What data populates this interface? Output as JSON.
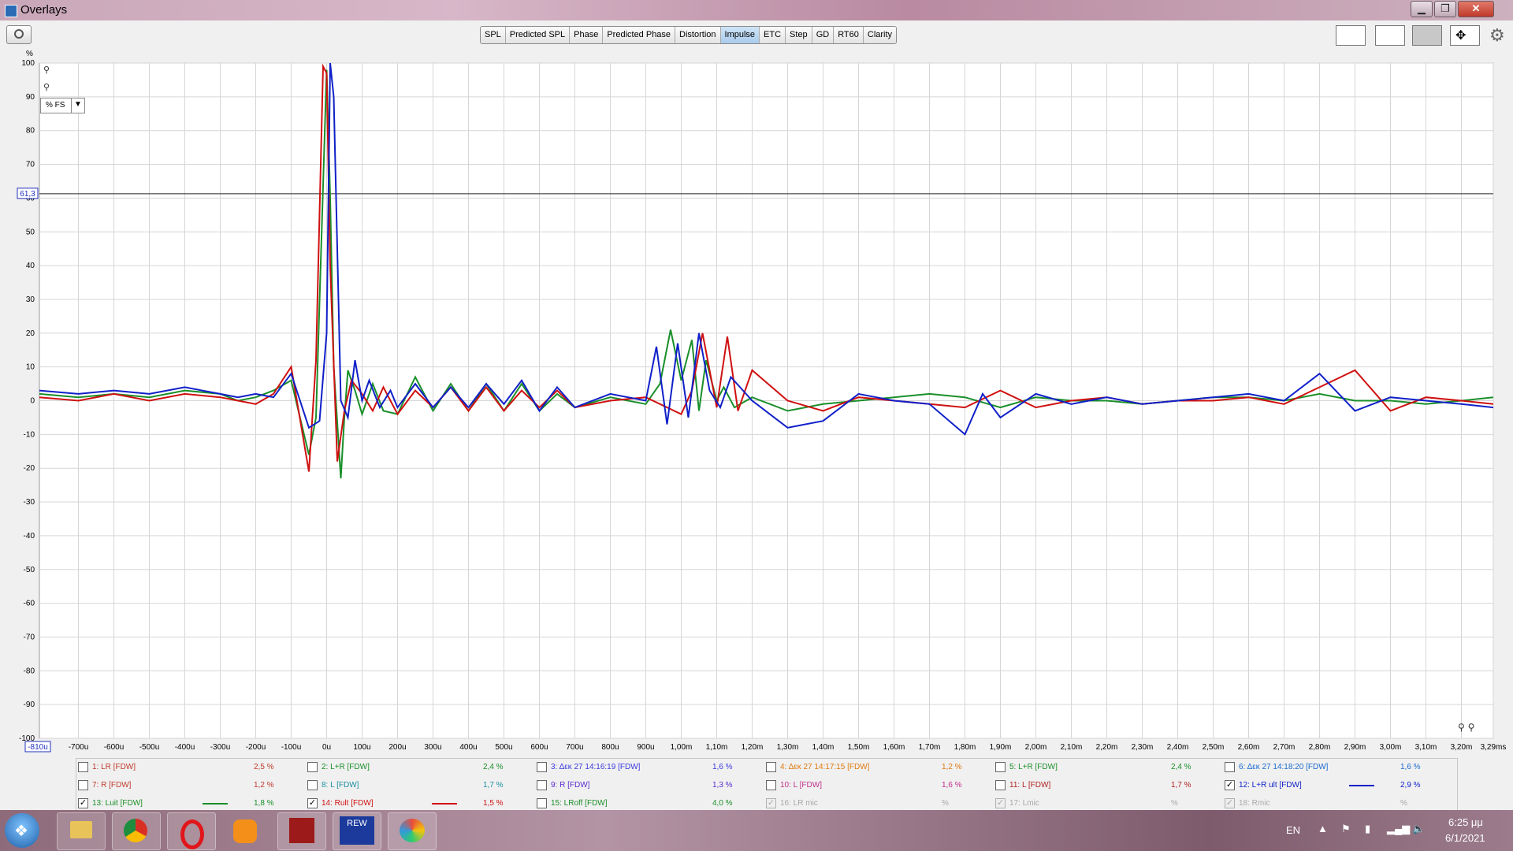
{
  "window": {
    "title": "Overlays",
    "minimize": "▁",
    "maximize": "❐",
    "close": "✕"
  },
  "tabs": [
    "SPL",
    "Predicted SPL",
    "Phase",
    "Predicted Phase",
    "Distortion",
    "Impulse",
    "ETC",
    "Step",
    "GD",
    "RT60",
    "Clarity"
  ],
  "active_tab": "Impulse",
  "y_unit_label": "%",
  "unit_select": "% FS",
  "cursor_value": "61,3",
  "x_cursor_value": "-810u",
  "chart_data": {
    "type": "line",
    "title": "",
    "xlabel": "",
    "ylabel": "%",
    "xlim": [
      -0.00081,
      0.00329
    ],
    "ylim": [
      -100,
      100
    ],
    "grid": true,
    "y_ticks": [
      "100",
      "90",
      "80",
      "70",
      "60",
      "50",
      "40",
      "30",
      "20",
      "10",
      "0",
      "-10",
      "-20",
      "-30",
      "-40",
      "-50",
      "-60",
      "-70",
      "-80",
      "-90",
      "-100"
    ],
    "x_ticks": [
      "-700u",
      "-600u",
      "-500u",
      "-400u",
      "-300u",
      "-200u",
      "-100u",
      "0u",
      "100u",
      "200u",
      "300u",
      "400u",
      "500u",
      "600u",
      "700u",
      "800u",
      "900u",
      "1,00m",
      "1,10m",
      "1,20m",
      "1,30m",
      "1,40m",
      "1,50m",
      "1,60m",
      "1,70m",
      "1,80m",
      "1,90m",
      "2,00m",
      "2,10m",
      "2,20m",
      "2,30m",
      "2,40m",
      "2,50m",
      "2,60m",
      "2,70m",
      "2,80m",
      "2,90m",
      "3,00m",
      "3,10m",
      "3,20m",
      "3,29ms"
    ],
    "cursor_y": 61.3,
    "series": [
      {
        "name": "13: Luit [FDW]",
        "color": "#1a8f2a",
        "x": [
          -0.00081,
          -0.0007,
          -0.0006,
          -0.0005,
          -0.0004,
          -0.0003,
          -0.00025,
          -0.0002,
          -0.00015,
          -0.0001,
          -5e-05,
          -3e-05,
          0,
          1e-05,
          2e-05,
          4e-05,
          5e-05,
          6e-05,
          8e-05,
          0.0001,
          0.00013,
          0.00016,
          0.0002,
          0.00025,
          0.0003,
          0.00035,
          0.0004,
          0.00045,
          0.0005,
          0.00055,
          0.0006,
          0.00065,
          0.0007,
          0.0008,
          0.0009,
          0.00094,
          0.00097,
          0.001,
          0.00103,
          0.00105,
          0.00107,
          0.0011,
          0.00112,
          0.00115,
          0.0012,
          0.0013,
          0.0014,
          0.0015,
          0.0016,
          0.0017,
          0.0018,
          0.0019,
          0.002,
          0.0021,
          0.0022,
          0.0023,
          0.0024,
          0.0025,
          0.0026,
          0.0027,
          0.0028,
          0.0029,
          0.003,
          0.0031,
          0.0032,
          0.00329
        ],
        "y": [
          2,
          1,
          2,
          1,
          3,
          2,
          0,
          1,
          3,
          6,
          -16,
          -5,
          98,
          60,
          10,
          -23,
          -5,
          9,
          3,
          -4,
          5,
          -3,
          -4,
          7,
          -3,
          5,
          -3,
          5,
          -3,
          5,
          -3,
          2,
          -2,
          1,
          -1,
          5,
          21,
          6,
          18,
          -3,
          12,
          0,
          4,
          -2,
          1,
          -3,
          -1,
          0,
          1,
          2,
          1,
          -2,
          1,
          0,
          0,
          -1,
          0,
          1,
          1,
          0,
          2,
          0,
          0,
          -1,
          0,
          1
        ]
      },
      {
        "name": "14: Rult [FDW]",
        "color": "#d01010",
        "x": [
          -0.00081,
          -0.0007,
          -0.0006,
          -0.0005,
          -0.0004,
          -0.0003,
          -0.00025,
          -0.0002,
          -0.00015,
          -0.0001,
          -5e-05,
          -3e-05,
          -1e-05,
          0,
          1e-05,
          3e-05,
          5e-05,
          7e-05,
          0.0001,
          0.00013,
          0.00016,
          0.0002,
          0.00025,
          0.0003,
          0.00035,
          0.0004,
          0.00045,
          0.0005,
          0.00055,
          0.0006,
          0.00065,
          0.0007,
          0.0008,
          0.0009,
          0.001,
          0.00103,
          0.00106,
          0.0011,
          0.00113,
          0.00116,
          0.0012,
          0.0013,
          0.0014,
          0.0015,
          0.0016,
          0.0017,
          0.0018,
          0.0019,
          0.002,
          0.0021,
          0.0022,
          0.0023,
          0.0024,
          0.0025,
          0.0026,
          0.0027,
          0.0028,
          0.0029,
          0.003,
          0.0031,
          0.0032,
          0.00329
        ],
        "y": [
          1,
          0,
          2,
          0,
          2,
          1,
          0,
          -1,
          2,
          10,
          -21,
          12,
          99,
          97,
          40,
          -18,
          -3,
          6,
          2,
          -3,
          4,
          -4,
          3,
          -2,
          4,
          -3,
          4,
          -3,
          3,
          -2,
          3,
          -2,
          0,
          1,
          -4,
          3,
          20,
          -2,
          19,
          -3,
          9,
          0,
          -3,
          1,
          0,
          -1,
          -2,
          3,
          -2,
          0,
          1,
          -1,
          0,
          0,
          1,
          -1,
          4,
          9,
          -3,
          1,
          0,
          -1
        ]
      },
      {
        "name": "12: L+R ult [FDW]",
        "color": "#1020c8",
        "x": [
          -0.00081,
          -0.0007,
          -0.0006,
          -0.0005,
          -0.0004,
          -0.0003,
          -0.00025,
          -0.0002,
          -0.00015,
          -0.0001,
          -5e-05,
          -2e-05,
          0,
          1e-05,
          2e-05,
          4e-05,
          6e-05,
          8e-05,
          0.0001,
          0.00012,
          0.00015,
          0.00018,
          0.0002,
          0.00025,
          0.0003,
          0.00035,
          0.0004,
          0.00045,
          0.0005,
          0.00055,
          0.0006,
          0.00065,
          0.0007,
          0.0008,
          0.0009,
          0.00093,
          0.00096,
          0.00099,
          0.00102,
          0.00105,
          0.00108,
          0.00111,
          0.00114,
          0.0012,
          0.0013,
          0.0014,
          0.0015,
          0.0016,
          0.0017,
          0.0018,
          0.00185,
          0.0019,
          0.002,
          0.0021,
          0.0022,
          0.0023,
          0.0024,
          0.0025,
          0.0026,
          0.0027,
          0.0028,
          0.0029,
          0.003,
          0.0031,
          0.0032,
          0.00329
        ],
        "y": [
          3,
          2,
          3,
          2,
          4,
          2,
          1,
          2,
          1,
          8,
          -8,
          -6,
          20,
          100,
          90,
          0,
          -5,
          12,
          0,
          6,
          -2,
          3,
          -2,
          5,
          -2,
          4,
          -2,
          5,
          -1,
          6,
          -3,
          4,
          -2,
          2,
          0,
          16,
          -7,
          17,
          -5,
          20,
          3,
          -2,
          7,
          0,
          -8,
          -6,
          2,
          0,
          -1,
          -10,
          2,
          -5,
          2,
          -1,
          1,
          -1,
          0,
          1,
          2,
          0,
          8,
          -3,
          1,
          0,
          -1,
          -2
        ]
      }
    ]
  },
  "legend": [
    {
      "label": "1: LR [FDW]",
      "value": "2,5 %",
      "color": "#c0392b",
      "checked": false,
      "line": ""
    },
    {
      "label": "2: L+R [FDW]",
      "value": "2,4 %",
      "color": "#1a8f2a",
      "checked": false,
      "line": ""
    },
    {
      "label": "3: Δεκ 27 14:16:19 [FDW]",
      "value": "1,6 %",
      "color": "#3a3ae0",
      "checked": false,
      "line": ""
    },
    {
      "label": "4: Δεκ 27 14:17:15 [FDW]",
      "value": "1,2 %",
      "color": "#e07a10",
      "checked": false,
      "line": ""
    },
    {
      "label": "5: L+R [FDW]",
      "value": "2,4 %",
      "color": "#1a8f2a",
      "checked": false,
      "line": ""
    },
    {
      "label": "6: Δεκ 27 14:18:20 [FDW]",
      "value": "1,6 %",
      "color": "#1a6ad0",
      "checked": false,
      "line": ""
    },
    {
      "label": "7: R [FDW]",
      "value": "1,2 %",
      "color": "#c0392b",
      "checked": false,
      "line": ""
    },
    {
      "label": "8: L [FDW]",
      "value": "1,7 %",
      "color": "#1a8fa0",
      "checked": false,
      "line": ""
    },
    {
      "label": "9: R [FDW]",
      "value": "1,3 %",
      "color": "#5a2ad0",
      "checked": false,
      "line": ""
    },
    {
      "label": "10: L [FDW]",
      "value": "1,6 %",
      "color": "#c0308a",
      "checked": false,
      "line": ""
    },
    {
      "label": "11: L [FDW]",
      "value": "1,7 %",
      "color": "#b02020",
      "checked": false,
      "line": ""
    },
    {
      "label": "12: L+R ult [FDW]",
      "value": "2,9 %",
      "color": "#1020c8",
      "checked": true,
      "line": "#1020c8"
    },
    {
      "label": "13: Luit [FDW]",
      "value": "1,8 %",
      "color": "#1a8f2a",
      "checked": true,
      "line": "#1a8f2a"
    },
    {
      "label": "14: Rult [FDW]",
      "value": "1,5 %",
      "color": "#d01010",
      "checked": true,
      "line": "#d01010"
    },
    {
      "label": "15: LRoff [FDW]",
      "value": "4,0 %",
      "color": "#1a8f2a",
      "checked": false,
      "line": ""
    },
    {
      "label": "16: LR mic",
      "value": "%",
      "color": "#a8a8a8",
      "checked": true,
      "line": "",
      "disabled": true
    },
    {
      "label": "17: Lmic",
      "value": "%",
      "color": "#a8a8a8",
      "checked": true,
      "line": "",
      "disabled": true
    },
    {
      "label": "18: Rmic",
      "value": "%",
      "color": "#a8a8a8",
      "checked": true,
      "line": "",
      "disabled": true
    }
  ],
  "taskbar": {
    "apps": [
      "windows-start",
      "file-explorer",
      "chrome",
      "opera",
      "brave",
      "app-red",
      "rew",
      "paint"
    ],
    "rew_text": "REW",
    "lang": "EN",
    "time": "6:25 μμ",
    "date": "6/1/2021"
  }
}
